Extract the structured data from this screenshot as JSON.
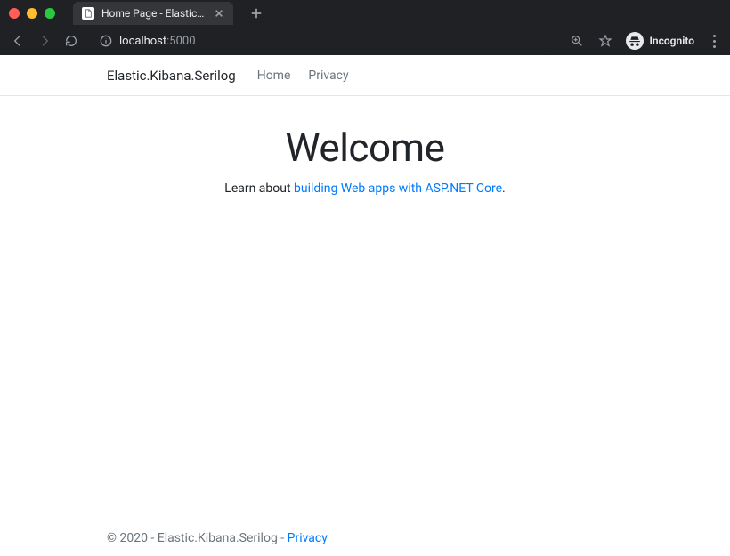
{
  "browser": {
    "tab_title": "Home Page - Elastic.Kibana.Se",
    "url_host": "localhost",
    "url_port": ":5000",
    "incognito_label": "Incognito"
  },
  "navbar": {
    "brand": "Elastic.Kibana.Serilog",
    "links": {
      "home": "Home",
      "privacy": "Privacy"
    }
  },
  "main": {
    "heading": "Welcome",
    "lead_prefix": "Learn about ",
    "lead_link": "building Web apps with ASP.NET Core",
    "lead_suffix": "."
  },
  "footer": {
    "text": "© 2020 - Elastic.Kibana.Serilog - ",
    "privacy_link": "Privacy"
  }
}
